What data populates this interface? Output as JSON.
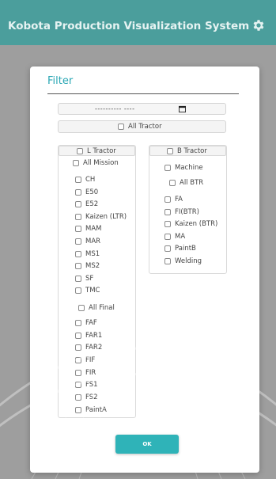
{
  "app": {
    "title": "Kobota Production Visualization System",
    "settings_icon": "gear-icon"
  },
  "modal": {
    "title": "Filter",
    "date_value": "---------- ----",
    "all_tractor": "All Tractor",
    "ok_label": "OK"
  },
  "l_tractor": {
    "header": "L Tractor",
    "all_mission": "All Mission",
    "mission_items": [
      "CH",
      "E50",
      "E52",
      "Kaizen (LTR)",
      "MAM",
      "MAR",
      "MS1",
      "MS2",
      "SF",
      "TMC"
    ],
    "all_final": "All Final",
    "final_items": [
      "FAF",
      "FAR1",
      "FAR2",
      "FIF",
      "FIR",
      "FS1",
      "FS2",
      "PaintA"
    ]
  },
  "b_tractor": {
    "header": "B Tractor",
    "machine": "Machine",
    "all_btr": "All BTR",
    "btr_items": [
      "FA",
      "FI(BTR)",
      "Kaizen (BTR)",
      "MA",
      "PaintB",
      "Welding"
    ]
  },
  "colors": {
    "appbar": "#4b9e9c",
    "accent": "#2aa7b4",
    "button": "#2fb3b8",
    "backdrop": "#9e9e9e"
  }
}
